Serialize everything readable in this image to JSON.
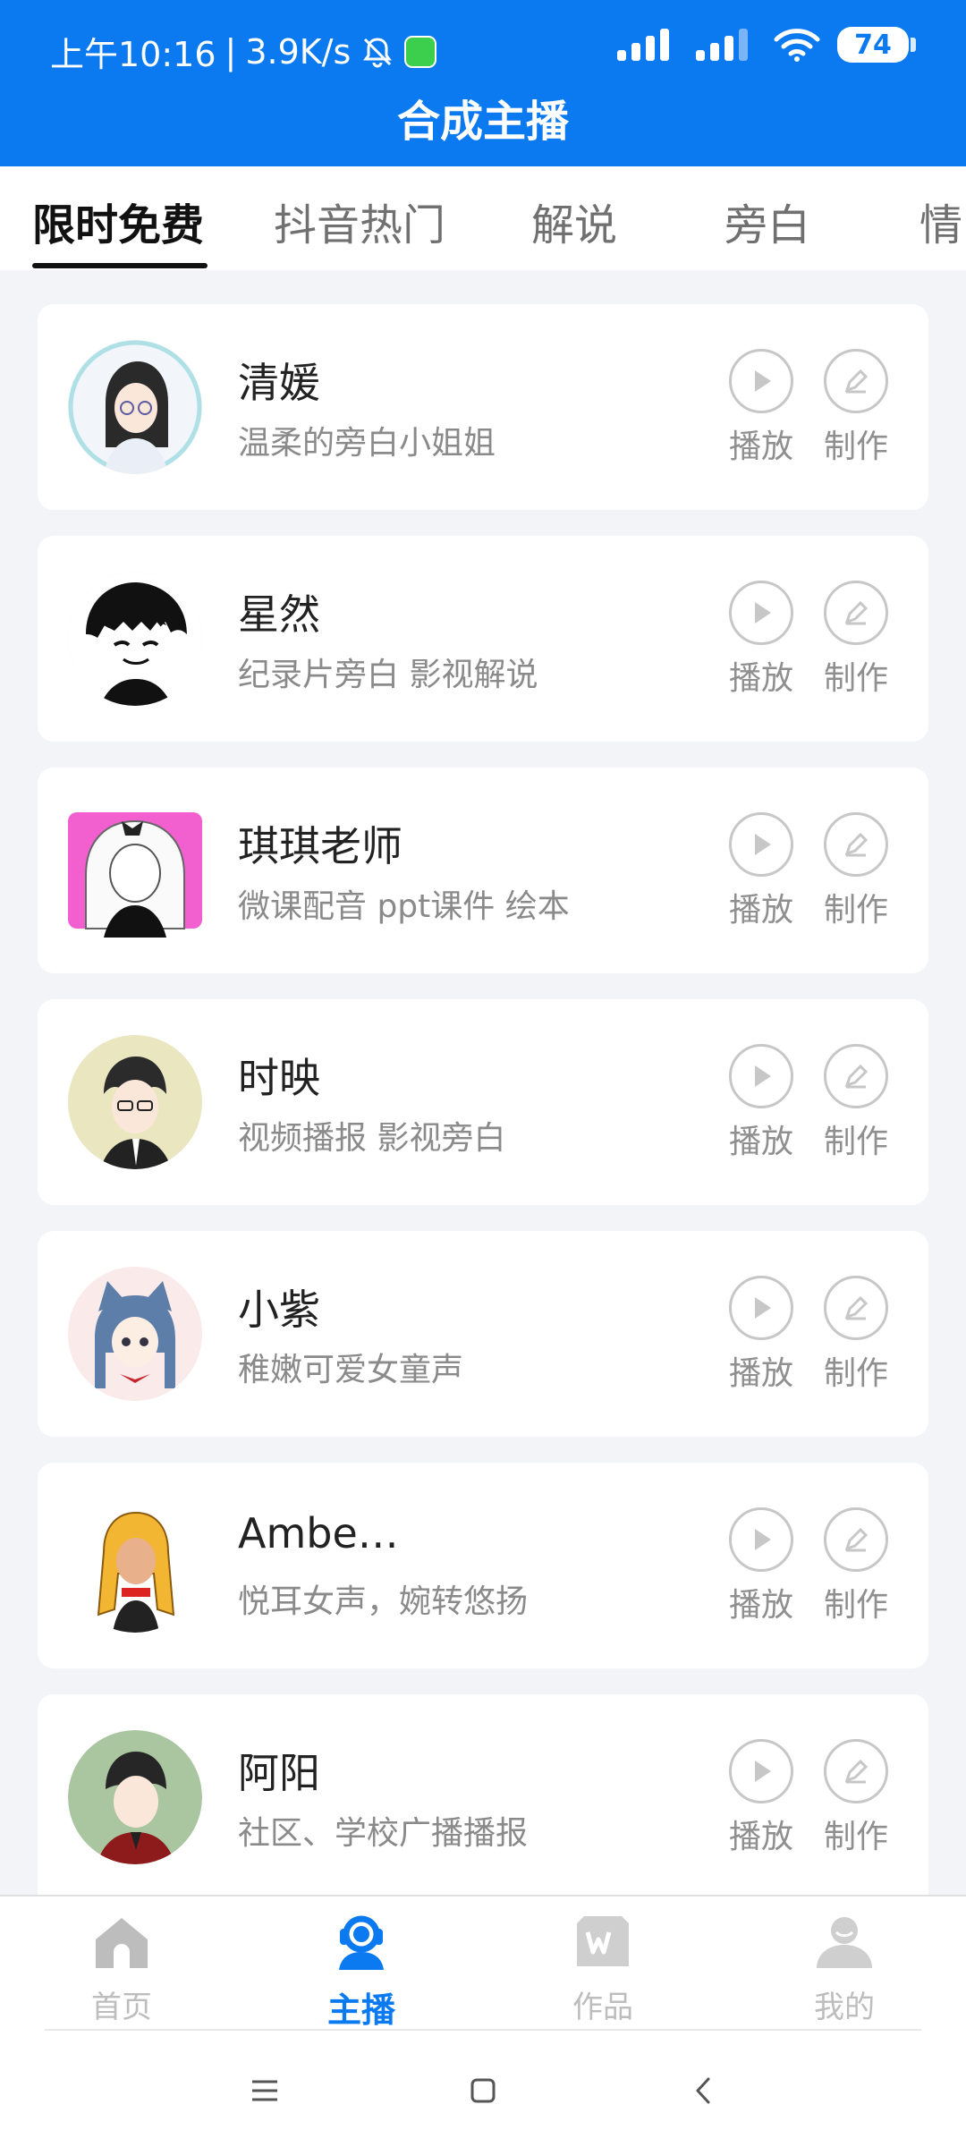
{
  "status": {
    "time": "上午10:16",
    "speed": "3.9K/s",
    "battery": "74"
  },
  "header": {
    "title": "合成主播"
  },
  "tabs": [
    {
      "label": "限时免费"
    },
    {
      "label": "抖音热门"
    },
    {
      "label": "解说"
    },
    {
      "label": "旁白"
    },
    {
      "label": "情"
    }
  ],
  "actions": {
    "play": "播放",
    "make": "制作"
  },
  "anchors": [
    {
      "name": "清媛",
      "desc": "温柔的旁白小姐姐"
    },
    {
      "name": "星然",
      "desc": "纪录片旁白  影视解说"
    },
    {
      "name": "琪琪老师",
      "desc": "微课配音 ppt课件 绘本"
    },
    {
      "name": "时映",
      "desc": "视频播报   影视旁白"
    },
    {
      "name": "小紫",
      "desc": "稚嫩可爱女童声"
    },
    {
      "name": "Ambe…",
      "desc": "悦耳女声，婉转悠扬"
    },
    {
      "name": "阿阳",
      "desc": "社区、学校广播播报"
    }
  ],
  "nav": [
    {
      "label": "首页"
    },
    {
      "label": "主播"
    },
    {
      "label": "作品"
    },
    {
      "label": "我的"
    }
  ],
  "colors": {
    "primary": "#0b79f0"
  }
}
